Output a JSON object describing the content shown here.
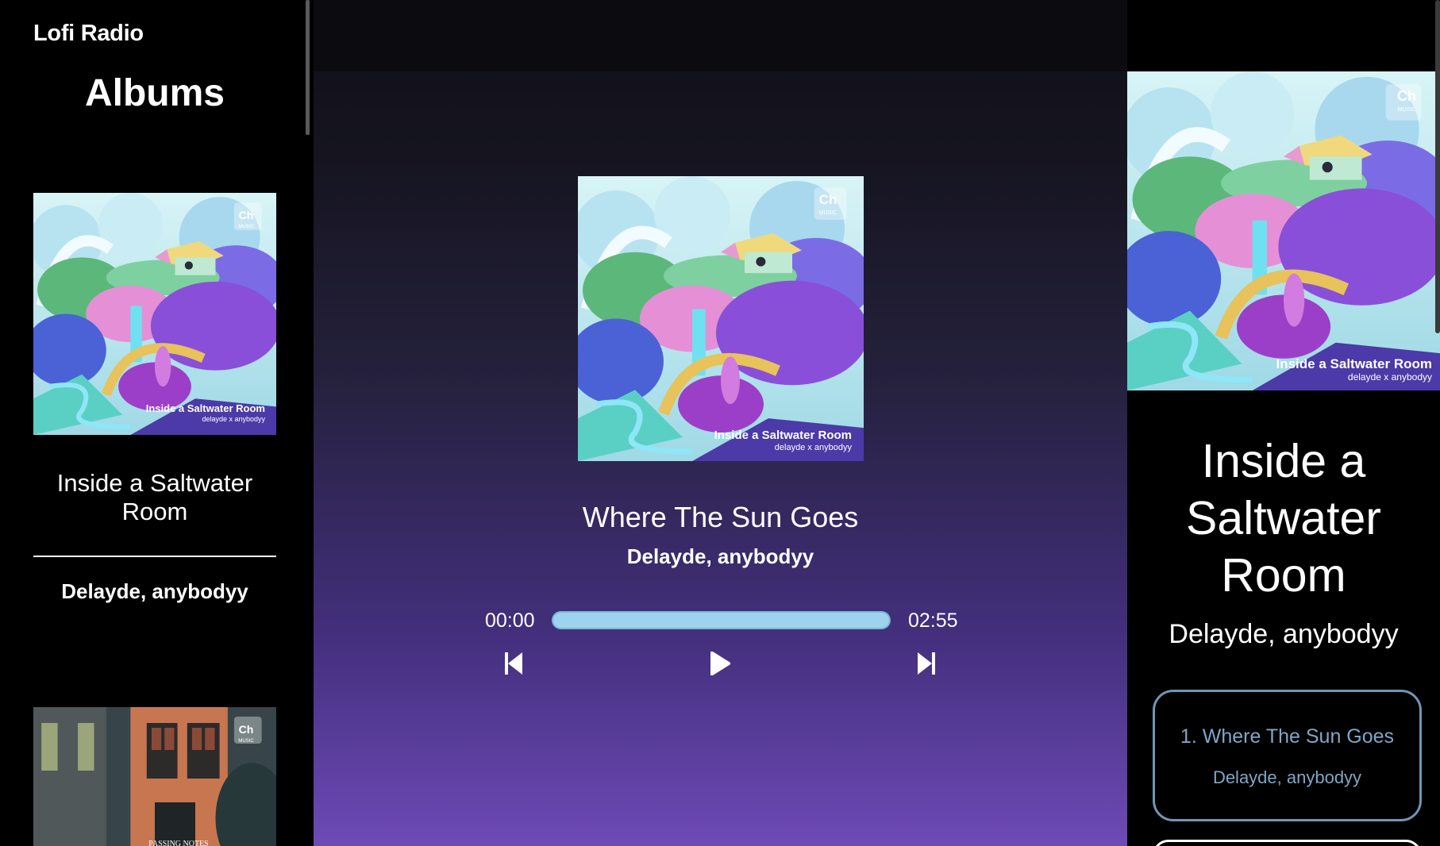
{
  "sidebar": {
    "brand": "Lofi Radio",
    "heading": "Albums",
    "albums": [
      {
        "title": "Inside a Saltwater Room",
        "artist": "Delayde, anybodyy",
        "cover_text": "Inside a Saltwater Room",
        "cover_subtext": "delayde x anybodyy"
      },
      {
        "title": "",
        "artist": "",
        "cover_text": "PASSING NOTES",
        "cover_subtext": ""
      }
    ]
  },
  "cover_badge": "Ch",
  "cover_badge_sub": "MUSIC",
  "player": {
    "cover_text": "Inside a Saltwater Room",
    "cover_subtext": "delayde x anybodyy",
    "track_title": "Where The Sun Goes",
    "track_artist": "Delayde, anybodyy",
    "current_time": "00:00",
    "total_time": "02:55",
    "progress": 1.0
  },
  "album_panel": {
    "title": "Inside a Saltwater Room",
    "artist": "Delayde, anybodyy",
    "cover_text": "Inside a Saltwater Room",
    "cover_subtext": "delayde x anybodyy",
    "tracks": [
      {
        "label": "1. Where The Sun Goes",
        "artist": "Delayde, anybodyy"
      }
    ]
  },
  "icons": {
    "prev": "skip-previous-icon",
    "play": "play-icon",
    "next": "skip-next-icon"
  },
  "colors": {
    "progress_fill": "#9ed3ee",
    "track_item_border": "#6e97b6",
    "track_item_text": "#7fa7c6"
  }
}
